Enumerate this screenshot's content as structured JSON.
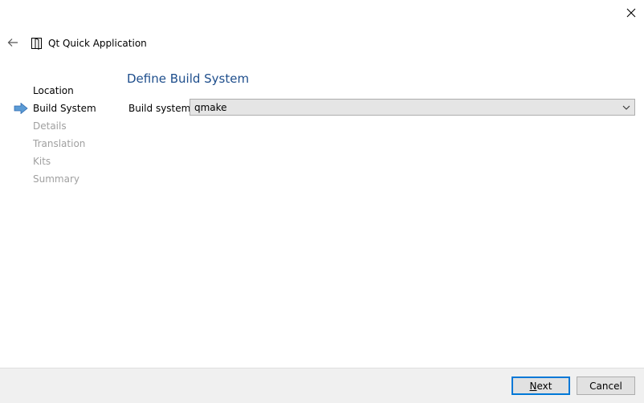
{
  "window": {
    "title": "Qt Quick Application"
  },
  "steps": [
    {
      "label": "Location",
      "state": "done"
    },
    {
      "label": "Build System",
      "state": "current"
    },
    {
      "label": "Details",
      "state": "pending"
    },
    {
      "label": "Translation",
      "state": "pending"
    },
    {
      "label": "Kits",
      "state": "pending"
    },
    {
      "label": "Summary",
      "state": "pending"
    }
  ],
  "page": {
    "heading": "Define Build System",
    "build_system_label": "Build system:",
    "build_system_value": "qmake"
  },
  "footer": {
    "next_mnemonic": "N",
    "next_rest": "ext",
    "cancel_label": "Cancel"
  },
  "colors": {
    "heading": "#1e4e8c",
    "current_arrow": "#5b9bd5",
    "default_button_border": "#0078d7",
    "pending_step_text": "#a0a0a0"
  },
  "icons": [
    "close-icon",
    "back-arrow-icon",
    "wizard-page-icon",
    "current-step-arrow-icon",
    "chevron-down-icon"
  ]
}
